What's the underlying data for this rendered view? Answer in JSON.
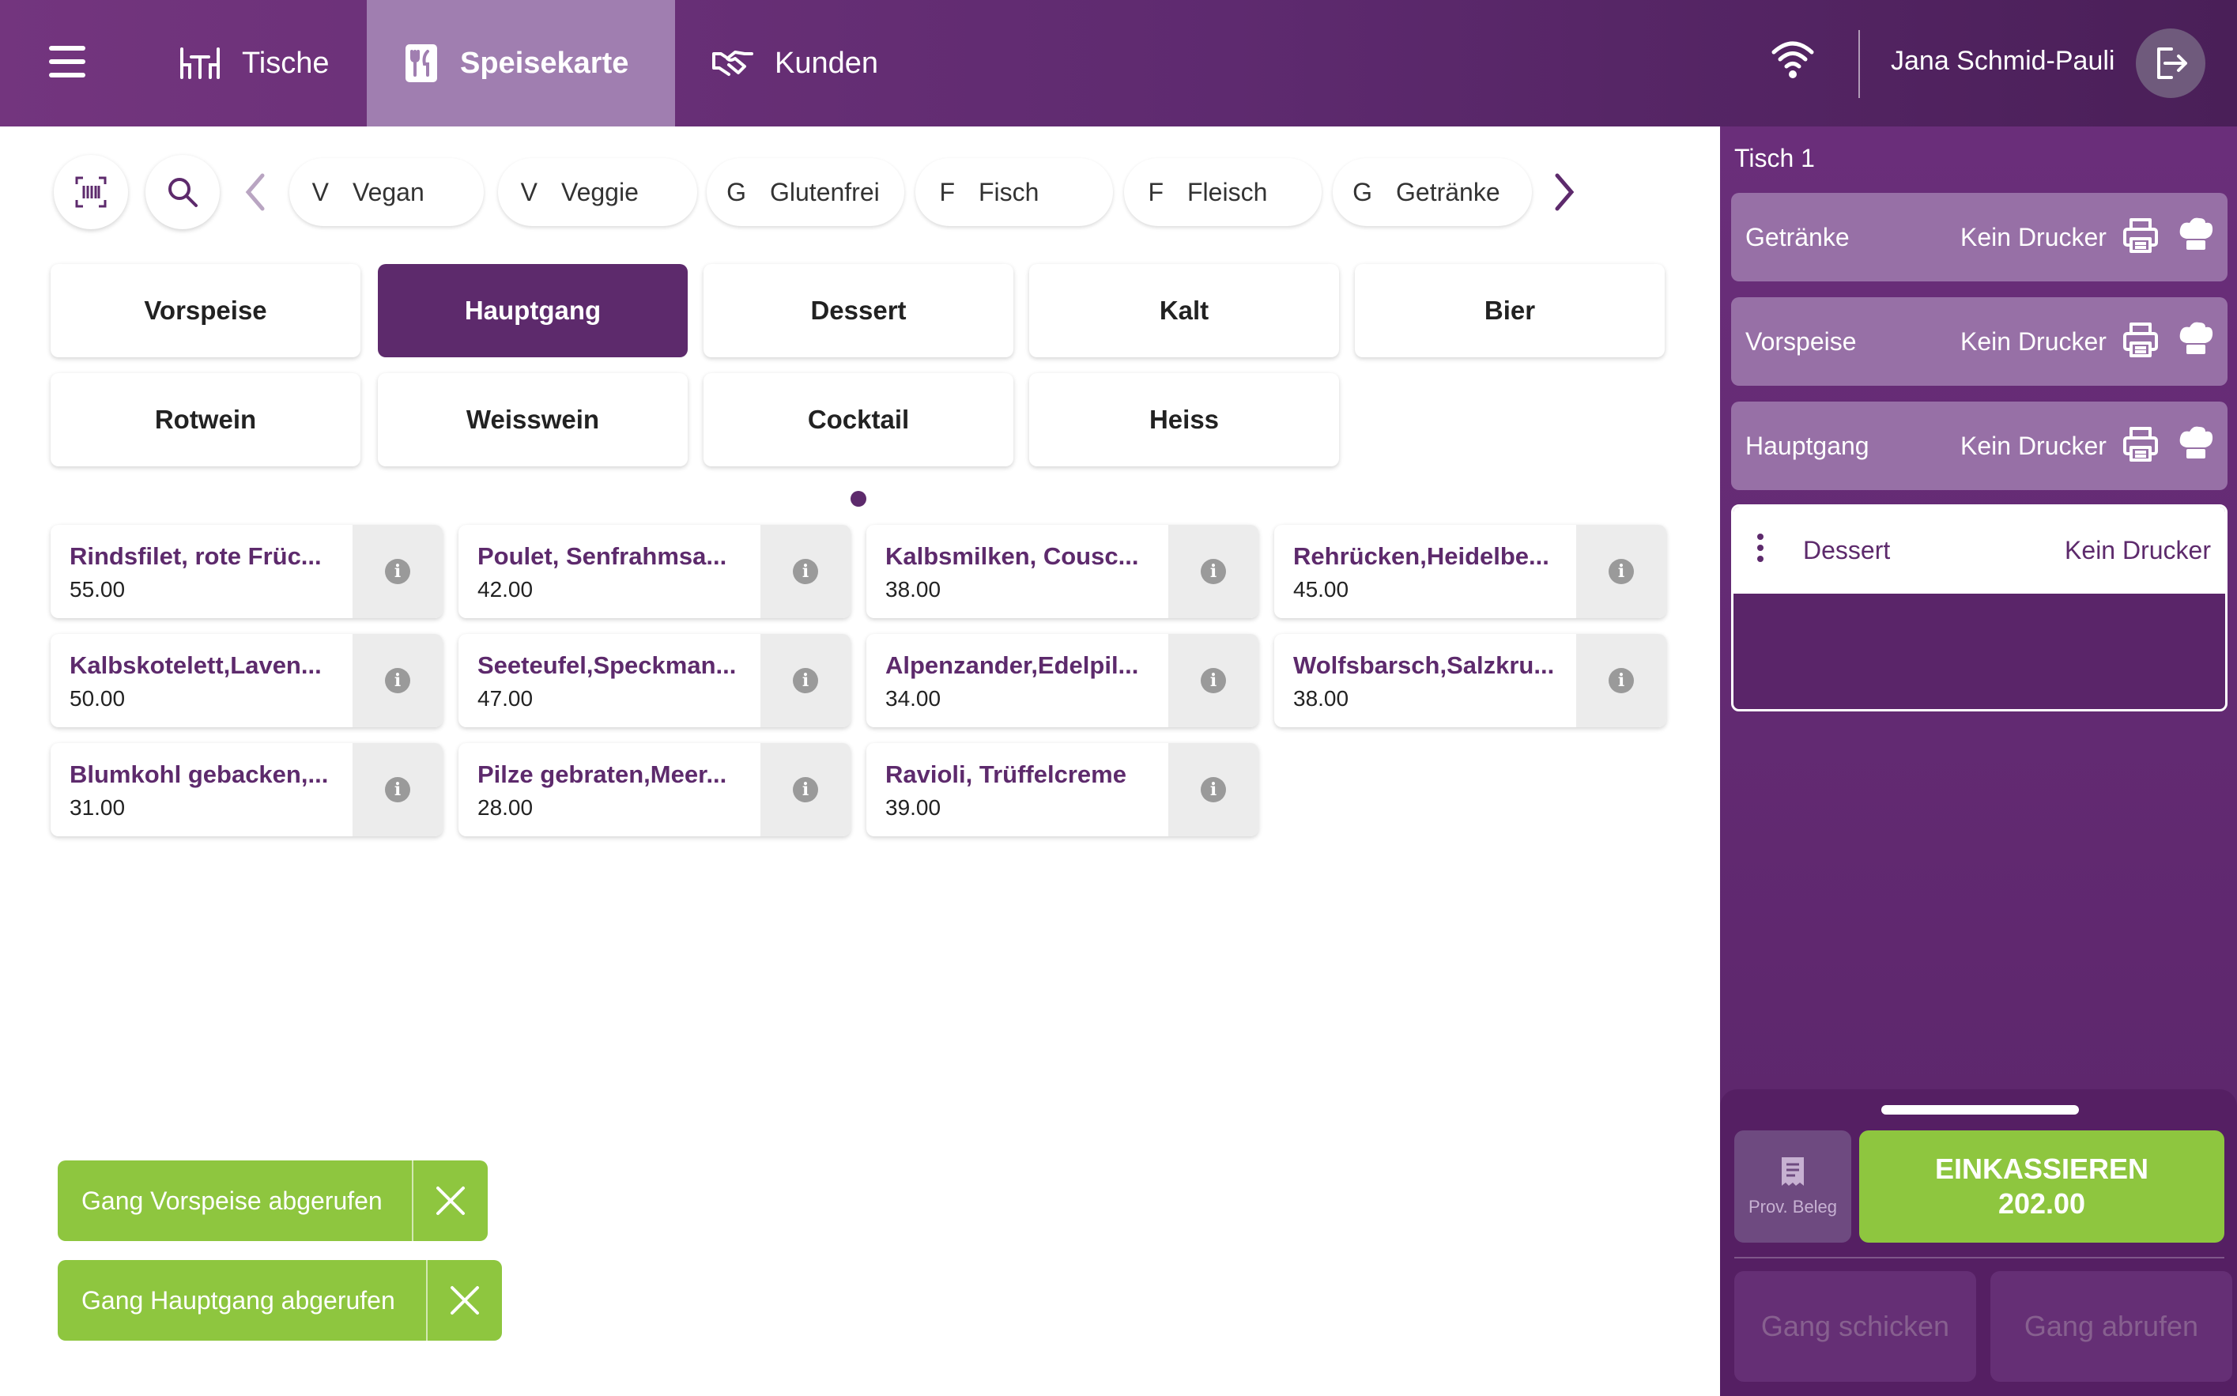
{
  "topbar": {
    "tabs": [
      {
        "label": "Tische"
      },
      {
        "label": "Speisekarte"
      },
      {
        "label": "Kunden"
      }
    ],
    "user_name": "Jana Schmid-Pauli"
  },
  "filters": [
    {
      "letter": "V",
      "label": "Vegan"
    },
    {
      "letter": "V",
      "label": "Veggie"
    },
    {
      "letter": "G",
      "label": "Glutenfrei"
    },
    {
      "letter": "F",
      "label": "Fisch"
    },
    {
      "letter": "F",
      "label": "Fleisch"
    },
    {
      "letter": "G",
      "label": "Getränke"
    }
  ],
  "categories": [
    {
      "label": "Vorspeise"
    },
    {
      "label": "Hauptgang",
      "selected": true
    },
    {
      "label": "Dessert"
    },
    {
      "label": "Kalt"
    },
    {
      "label": "Bier"
    },
    {
      "label": "Rotwein"
    },
    {
      "label": "Weisswein"
    },
    {
      "label": "Cocktail"
    },
    {
      "label": "Heiss"
    }
  ],
  "dishes": [
    {
      "name": "Rindsfilet, rote Früc...",
      "price": "55.00"
    },
    {
      "name": "Poulet, Senfrahmsa...",
      "price": "42.00"
    },
    {
      "name": "Kalbsmilken, Cousc...",
      "price": "38.00"
    },
    {
      "name": "Rehrücken,Heidelbe...",
      "price": "45.00"
    },
    {
      "name": "Kalbskotelett,Laven...",
      "price": "50.00"
    },
    {
      "name": "Seeteufel,Speckman...",
      "price": "47.00"
    },
    {
      "name": "Alpenzander,Edelpil...",
      "price": "34.00"
    },
    {
      "name": "Wolfsbarsch,Salzkru...",
      "price": "38.00"
    },
    {
      "name": "Blumkohl gebacken,...",
      "price": "31.00"
    },
    {
      "name": "Pilze gebraten,Meer...",
      "price": "28.00"
    },
    {
      "name": "Ravioli, Trüffelcreme",
      "price": "39.00"
    }
  ],
  "toasts": [
    {
      "text": "Gang Vorspeise abgerufen"
    },
    {
      "text": "Gang Hauptgang abgerufen"
    }
  ],
  "order_panel": {
    "table_title": "Tisch 1",
    "courses": [
      {
        "name": "Getränke",
        "printer": "Kein Drucker"
      },
      {
        "name": "Vorspeise",
        "printer": "Kein Drucker"
      },
      {
        "name": "Hauptgang",
        "printer": "Kein Drucker"
      },
      {
        "name": "Dessert",
        "printer": "Kein Drucker",
        "active": true
      }
    ],
    "prov_beleg_label": "Prov. Beleg",
    "pay_label": "EINKASSIEREN",
    "pay_total": "202.00",
    "send_course_label": "Gang schicken",
    "call_course_label": "Gang abrufen"
  },
  "colors": {
    "brand_purple": "#5d2a6c",
    "accent_green": "#8ec63f"
  }
}
